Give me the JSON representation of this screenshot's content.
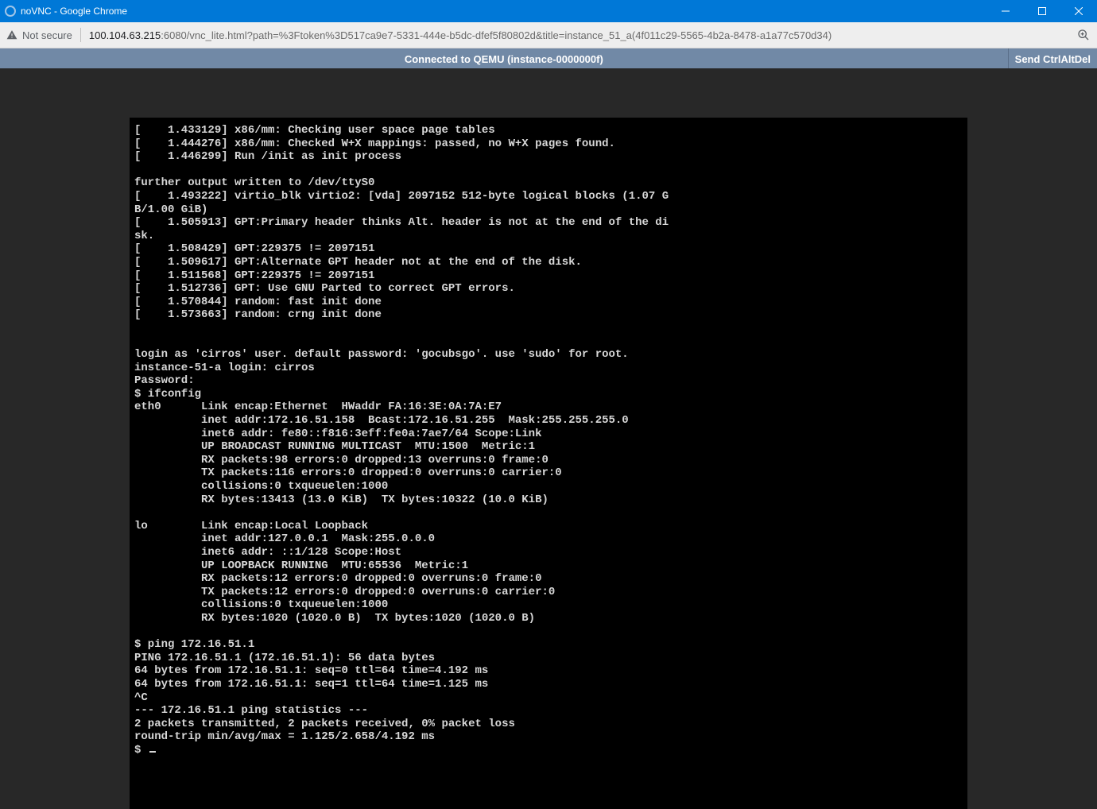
{
  "window": {
    "title": "noVNC - Google Chrome"
  },
  "addressbar": {
    "not_secure_label": "Not secure",
    "url_host": "100.104.63.215",
    "url_rest": ":6080/vnc_lite.html?path=%3Ftoken%3D517ca9e7-5331-444e-b5dc-dfef5f80802d&title=instance_51_a(4f011c29-5565-4b2a-8478-a1a77c570d34)"
  },
  "vnc": {
    "status": "Connected to QEMU (instance-0000000f)",
    "send_cad": "Send CtrlAltDel"
  },
  "console": {
    "lines": [
      "[    1.433129] x86/mm: Checking user space page tables",
      "[    1.444276] x86/mm: Checked W+X mappings: passed, no W+X pages found.",
      "[    1.446299] Run /init as init process",
      "",
      "further output written to /dev/ttyS0",
      "[    1.493222] virtio_blk virtio2: [vda] 2097152 512-byte logical blocks (1.07 G",
      "B/1.00 GiB)",
      "[    1.505913] GPT:Primary header thinks Alt. header is not at the end of the di",
      "sk.",
      "[    1.508429] GPT:229375 != 2097151",
      "[    1.509617] GPT:Alternate GPT header not at the end of the disk.",
      "[    1.511568] GPT:229375 != 2097151",
      "[    1.512736] GPT: Use GNU Parted to correct GPT errors.",
      "[    1.570844] random: fast init done",
      "[    1.573663] random: crng init done",
      "",
      "",
      "login as 'cirros' user. default password: 'gocubsgo'. use 'sudo' for root.",
      "instance-51-a login: cirros",
      "Password:",
      "$ ifconfig",
      "eth0      Link encap:Ethernet  HWaddr FA:16:3E:0A:7A:E7",
      "          inet addr:172.16.51.158  Bcast:172.16.51.255  Mask:255.255.255.0",
      "          inet6 addr: fe80::f816:3eff:fe0a:7ae7/64 Scope:Link",
      "          UP BROADCAST RUNNING MULTICAST  MTU:1500  Metric:1",
      "          RX packets:98 errors:0 dropped:13 overruns:0 frame:0",
      "          TX packets:116 errors:0 dropped:0 overruns:0 carrier:0",
      "          collisions:0 txqueuelen:1000",
      "          RX bytes:13413 (13.0 KiB)  TX bytes:10322 (10.0 KiB)",
      "",
      "lo        Link encap:Local Loopback",
      "          inet addr:127.0.0.1  Mask:255.0.0.0",
      "          inet6 addr: ::1/128 Scope:Host",
      "          UP LOOPBACK RUNNING  MTU:65536  Metric:1",
      "          RX packets:12 errors:0 dropped:0 overruns:0 frame:0",
      "          TX packets:12 errors:0 dropped:0 overruns:0 carrier:0",
      "          collisions:0 txqueuelen:1000",
      "          RX bytes:1020 (1020.0 B)  TX bytes:1020 (1020.0 B)",
      "",
      "$ ping 172.16.51.1",
      "PING 172.16.51.1 (172.16.51.1): 56 data bytes",
      "64 bytes from 172.16.51.1: seq=0 ttl=64 time=4.192 ms",
      "64 bytes from 172.16.51.1: seq=1 ttl=64 time=1.125 ms",
      "^C",
      "--- 172.16.51.1 ping statistics ---",
      "2 packets transmitted, 2 packets received, 0% packet loss",
      "round-trip min/avg/max = 1.125/2.658/4.192 ms",
      "$ "
    ]
  }
}
